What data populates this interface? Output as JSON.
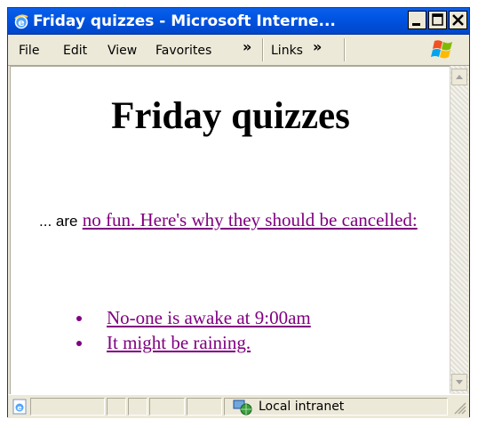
{
  "window": {
    "title": "Friday quizzes - Microsoft Interne..."
  },
  "menu": {
    "items": [
      "File",
      "Edit",
      "View",
      "Favorites"
    ],
    "links_label": "Links",
    "overflow_glyph": "»"
  },
  "page": {
    "heading": "Friday quizzes",
    "intro_lead": "... are",
    "intro_link": "no fun. Here's why they should be cancelled:",
    "reasons": [
      "No-one is awake at 9:00am",
      "It might be raining."
    ]
  },
  "status": {
    "zone": "Local intranet"
  },
  "colors": {
    "link_visited": "#800080",
    "titlebar": "#0054e3",
    "chrome": "#ece9d8"
  }
}
